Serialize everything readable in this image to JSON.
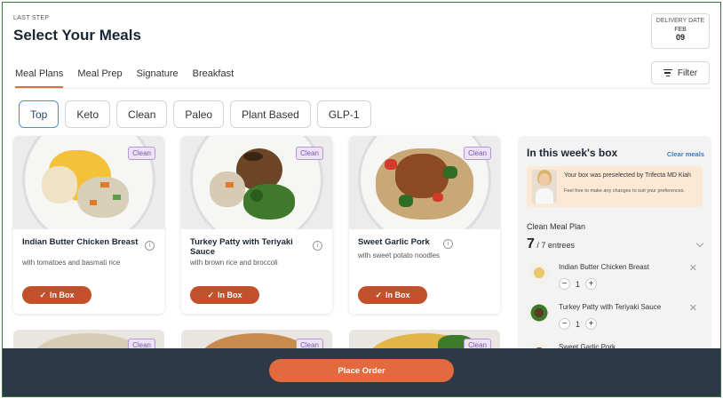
{
  "header": {
    "step_label": "LAST STEP",
    "title": "Select Your Meals"
  },
  "delivery": {
    "label": "DELIVERY DATE",
    "month": "FEB",
    "day": "09"
  },
  "tabs": [
    {
      "label": "Meal Plans",
      "active": true
    },
    {
      "label": "Meal Prep"
    },
    {
      "label": "Signature"
    },
    {
      "label": "Breakfast"
    }
  ],
  "filter_label": "Filter",
  "chips": [
    {
      "label": "Top",
      "active": true
    },
    {
      "label": "Keto"
    },
    {
      "label": "Clean"
    },
    {
      "label": "Paleo"
    },
    {
      "label": "Plant Based"
    },
    {
      "label": "GLP-1"
    }
  ],
  "meals": [
    {
      "name": "Indian Butter Chicken Breast",
      "desc": "with tomatoes and basmati rice",
      "tag": "Clean",
      "button": "In Box"
    },
    {
      "name": "Turkey Patty with Teriyaki Sauce",
      "desc": "with brown rice and broccoli",
      "tag": "Clean",
      "button": "In Box"
    },
    {
      "name": "Sweet Garlic Pork",
      "desc": "with sweet potato noodles",
      "tag": "Clean",
      "button": "In Box"
    }
  ],
  "row2_tags": [
    "Clean",
    "Clean",
    "Clean"
  ],
  "sidebar": {
    "title": "In this week's box",
    "clear": "Clear meals",
    "banner_text": "Your box was preselected by Trifecta MD Kiah",
    "banner_sub": "Feel free to make any changes to suit your preferences.",
    "plan": "Clean Meal Plan",
    "count_num": "7",
    "count_text": "/ 7 entrees",
    "items": [
      {
        "name": "Indian Butter Chicken Breast",
        "qty": "1"
      },
      {
        "name": "Turkey Patty with Teriyaki Sauce",
        "qty": "1"
      },
      {
        "name": "Sweet Garlic Pork"
      }
    ]
  },
  "place_order": "Place Order"
}
